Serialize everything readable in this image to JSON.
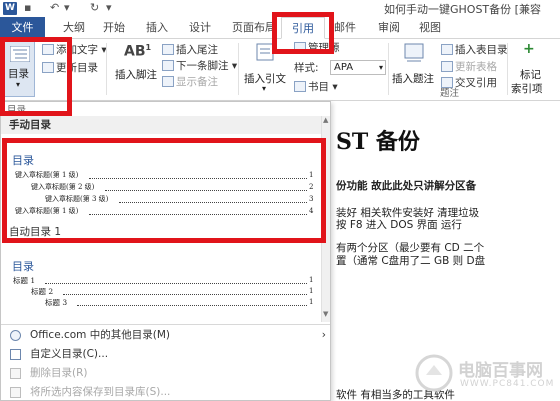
{
  "titlebar": {
    "app_letter": "W",
    "doc_title": "如何手动一键GHOST备份 [兼容"
  },
  "tabs": [
    {
      "id": "file",
      "label": "文件"
    },
    {
      "id": "outline",
      "label": "大纲"
    },
    {
      "id": "home",
      "label": "开始"
    },
    {
      "id": "insert",
      "label": "插入"
    },
    {
      "id": "design",
      "label": "设计"
    },
    {
      "id": "layout",
      "label": "页面布局"
    },
    {
      "id": "references",
      "label": "引用"
    },
    {
      "id": "mailings",
      "label": "邮件"
    },
    {
      "id": "review",
      "label": "审阅"
    },
    {
      "id": "view",
      "label": "视图"
    }
  ],
  "ribbon": {
    "toc_button": "目录",
    "add_text": "添加文字",
    "update_toc": "更新目录",
    "insert_footnote": "插入脚注",
    "insert_endnote": "插入尾注",
    "next_footnote": "下一条脚注",
    "show_notes": "显示备注",
    "insert_citation": "插入引文",
    "manage_sources": "管理源",
    "style_label": "样式:",
    "style_value": "APA",
    "bibliography": "书目",
    "insert_caption": "插入题注",
    "insert_table_of_figures": "插入表目录",
    "update_table": "更新表格",
    "cross_reference": "交叉引用",
    "captions_group": "题注",
    "mark_entry": "标记",
    "index_entry": "索引项"
  },
  "gallery": {
    "group_cut": "目录",
    "manual_heading": "手动目录",
    "auto1_title": "目录",
    "auto1_label": "自动目录 1",
    "auto1_lines": [
      {
        "text": "键入章标题(第 1 级)",
        "num": "1"
      },
      {
        "text": "键入章标题(第 2 级)",
        "num": "2"
      },
      {
        "text": "键入章标题(第 3 级)",
        "num": "3"
      },
      {
        "text": "键入章标题(第 1 级)",
        "num": "4"
      }
    ],
    "auto2_title": "目录",
    "auto2_lines": [
      {
        "text": "标题 1",
        "num": "1"
      },
      {
        "text": "标题 2",
        "num": "1"
      },
      {
        "text": "标题 3",
        "num": "1"
      }
    ],
    "menu": [
      {
        "label": "Office.com 中的其他目录(M)",
        "disabled": false,
        "arrow": "›"
      },
      {
        "label": "自定义目录(C)...",
        "disabled": false
      },
      {
        "label": "删除目录(R)",
        "disabled": true
      },
      {
        "label": "将所选内容保存到目录库(S)...",
        "disabled": true
      }
    ]
  },
  "document": {
    "heading": "ST 备份",
    "lines": [
      "份功能 故此此处只讲解分区备",
      "装好 相关软件安装好 清理垃圾",
      "按 F8 进入 DOS 界面  运行",
      "有两个分区（最少要有 CD 二个",
      "置（通常 C盘用了二 GB 则 D盘",
      "软件 有相当多的工具软件"
    ]
  },
  "watermark": {
    "text": "电脑百事网",
    "url": "WWW.PC841.COM"
  },
  "colors": {
    "accent": "#2b579a",
    "highlight": "#e1141a"
  }
}
